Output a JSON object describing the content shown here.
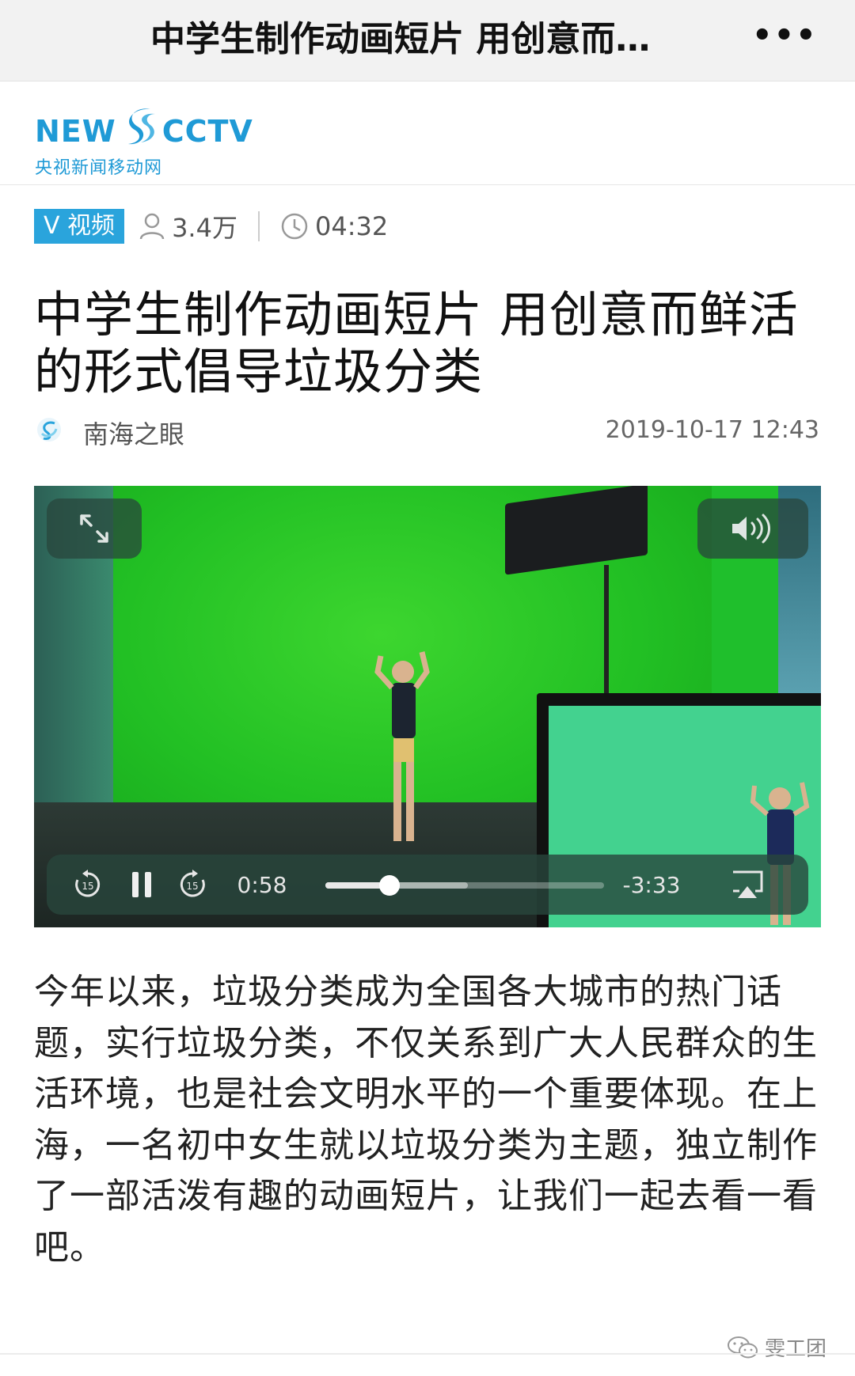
{
  "navbar": {
    "title": "中学生制作动画短片 用创意而…",
    "more_label": "•••"
  },
  "logo": {
    "word_left": "NEW",
    "word_right": "CCTV",
    "subtitle": "央视新闻移动网",
    "brand_color": "#1f9ad6"
  },
  "meta": {
    "badge": "V 视频",
    "views": "3.4万",
    "duration": "04:32",
    "badge_color": "#2aa4dc"
  },
  "headline": "中学生制作动画短片 用创意而鲜活的形式倡导垃圾分类",
  "source": {
    "name": "南海之眼",
    "date": "2019-10-17 12:43"
  },
  "video": {
    "elapsed": "0:58",
    "remaining": "-3:33",
    "progress": 0.23,
    "buffered": 0.51,
    "skip_back_seconds": "15",
    "skip_forward_seconds": "15"
  },
  "article": "今年以来，垃圾分类成为全国各大城市的热门话题，实行垃圾分类，不仅关系到广大人民群众的生活环境，也是社会文明水平的一个重要体现。在上海，一名初中女生就以垃圾分类为主题，独立制作了一部活泼有趣的动画短片，让我们一起去看一看吧。",
  "watermark": "雯工团"
}
